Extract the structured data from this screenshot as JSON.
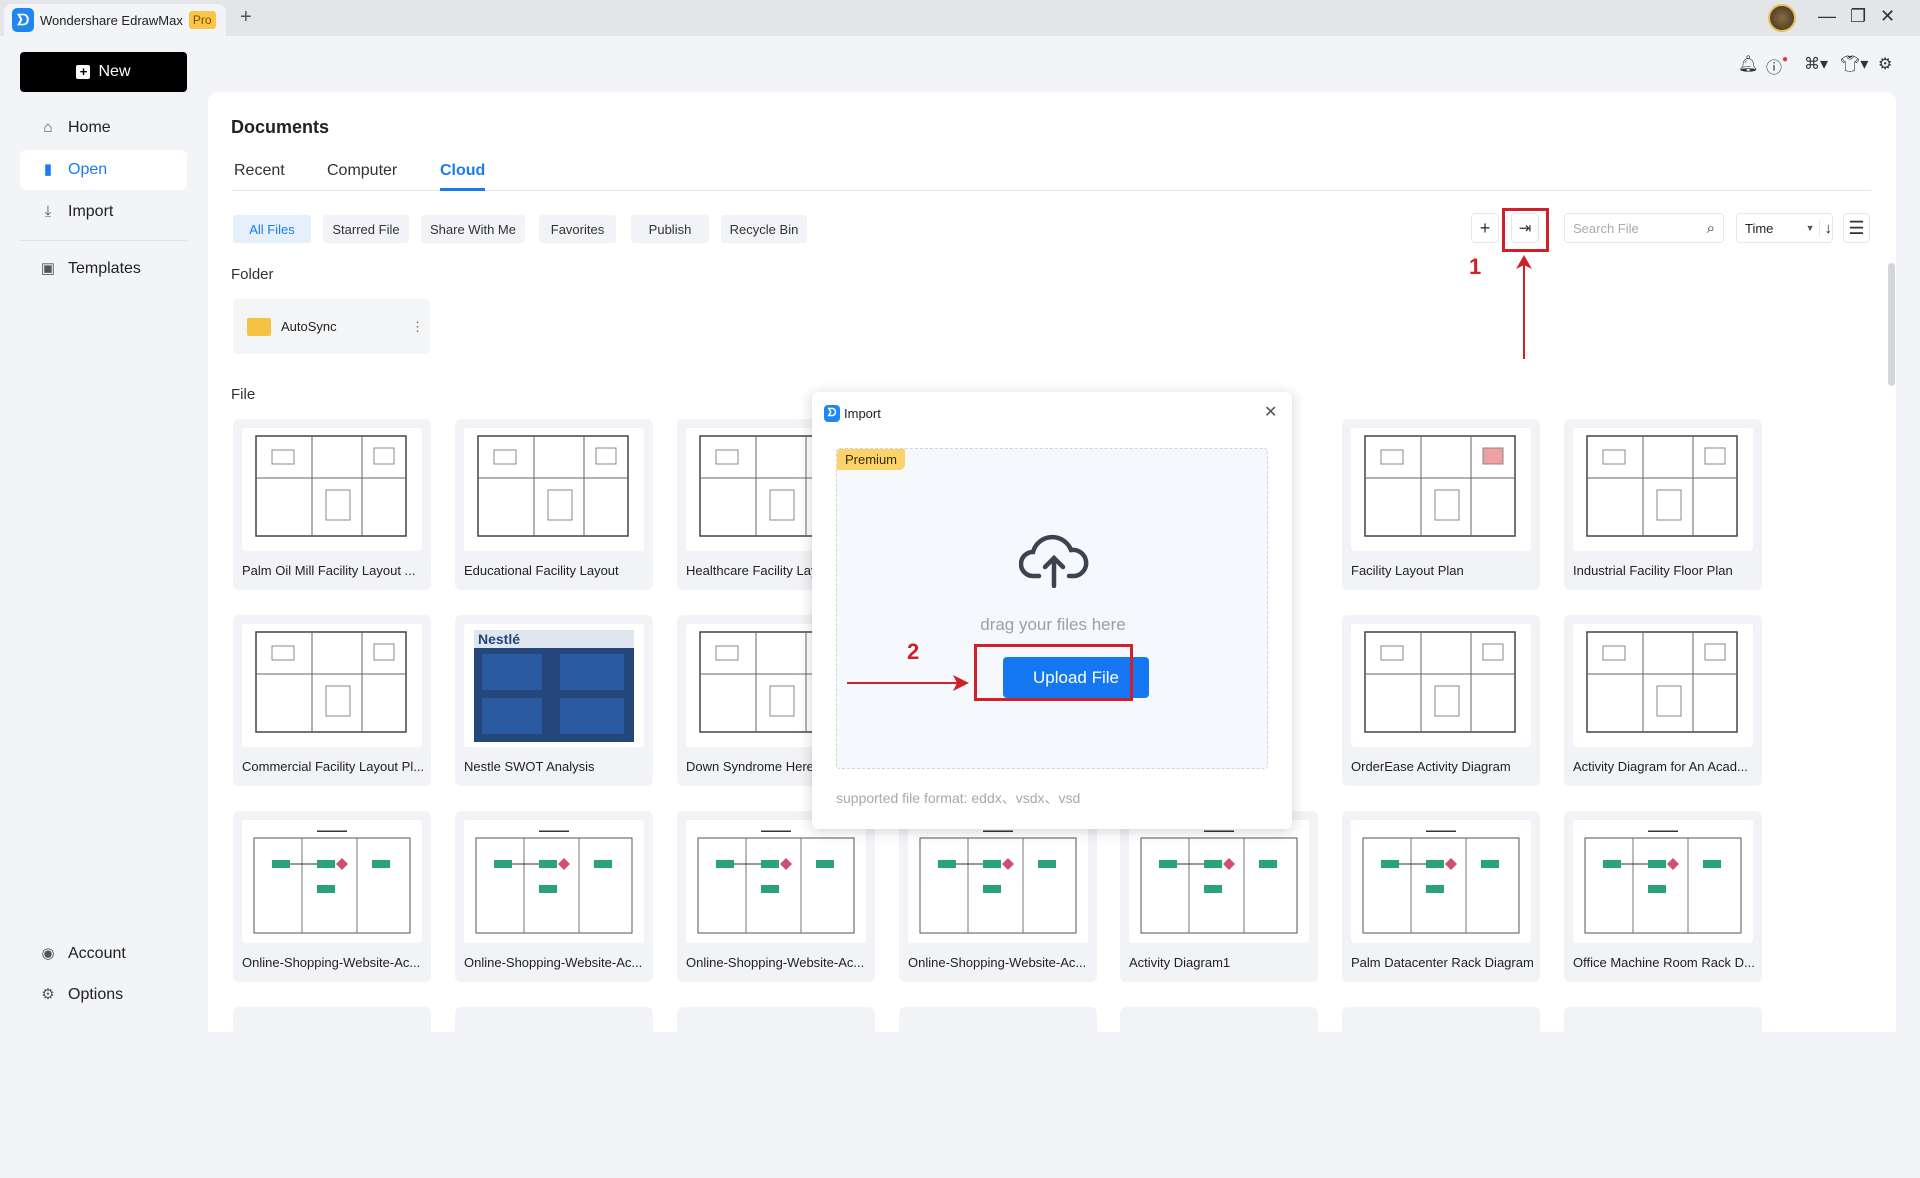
{
  "app": {
    "title": "Wondershare EdrawMax",
    "badge": "Pro",
    "new_tab": "+"
  },
  "window": {
    "minimize": "—",
    "restore": "❐",
    "close": "✕"
  },
  "sidebar": {
    "new_label": "New",
    "items": [
      {
        "label": "Home",
        "icon": "home-icon"
      },
      {
        "label": "Open",
        "icon": "file-icon",
        "active": true
      },
      {
        "label": "Import",
        "icon": "import-icon"
      },
      {
        "label": "Templates",
        "icon": "templates-icon"
      }
    ],
    "bottom": [
      {
        "label": "Account",
        "icon": "user-icon"
      },
      {
        "label": "Options",
        "icon": "gear-icon"
      }
    ]
  },
  "header_icons": [
    "bell-icon",
    "help-icon",
    "apps-icon",
    "shirt-icon",
    "settings-icon"
  ],
  "main": {
    "title": "Documents",
    "tabs": [
      {
        "label": "Recent"
      },
      {
        "label": "Computer"
      },
      {
        "label": "Cloud",
        "active": true
      }
    ],
    "filters": [
      "All Files",
      "Starred File",
      "Share With Me",
      "Favorites",
      "Publish",
      "Recycle Bin"
    ],
    "search_placeholder": "Search File",
    "sort": "Time",
    "folder_label": "Folder",
    "folders": [
      {
        "name": "AutoSync"
      }
    ],
    "file_label": "File",
    "files": [
      [
        "Palm Oil Mill Facility Layout ...",
        "Educational Facility Layout",
        "Healthcare Facility Lay",
        "",
        "Facility Layout Plan",
        "Industrial Facility Floor Plan"
      ],
      [
        "Commercial Facility Layout Pl...",
        "Nestle SWOT Analysis",
        "Down Syndrome Here",
        "",
        "OrderEase Activity Diagram",
        "Activity Diagram for An Acad..."
      ],
      [
        "Online-Shopping-Website-Ac...",
        "Online-Shopping-Website-Ac...",
        "Online-Shopping-Website-Ac...",
        "Online-Shopping-Website-Ac...",
        "Activity Diagram1",
        "Palm Datacenter Rack Diagram",
        "Office Machine Room Rack D..."
      ]
    ]
  },
  "annotations": {
    "step1": "1",
    "step2": "2",
    "color": "#d0202a"
  },
  "dialog": {
    "title": "Import",
    "badge": "Premium",
    "drag_text": "drag your files here",
    "upload_label": "Upload File",
    "supported": "supported file format: eddx、vsdx、vsd"
  },
  "colors": {
    "accent": "#1a7cf0",
    "upload": "#1677f2",
    "premium": "#fbd36b"
  }
}
